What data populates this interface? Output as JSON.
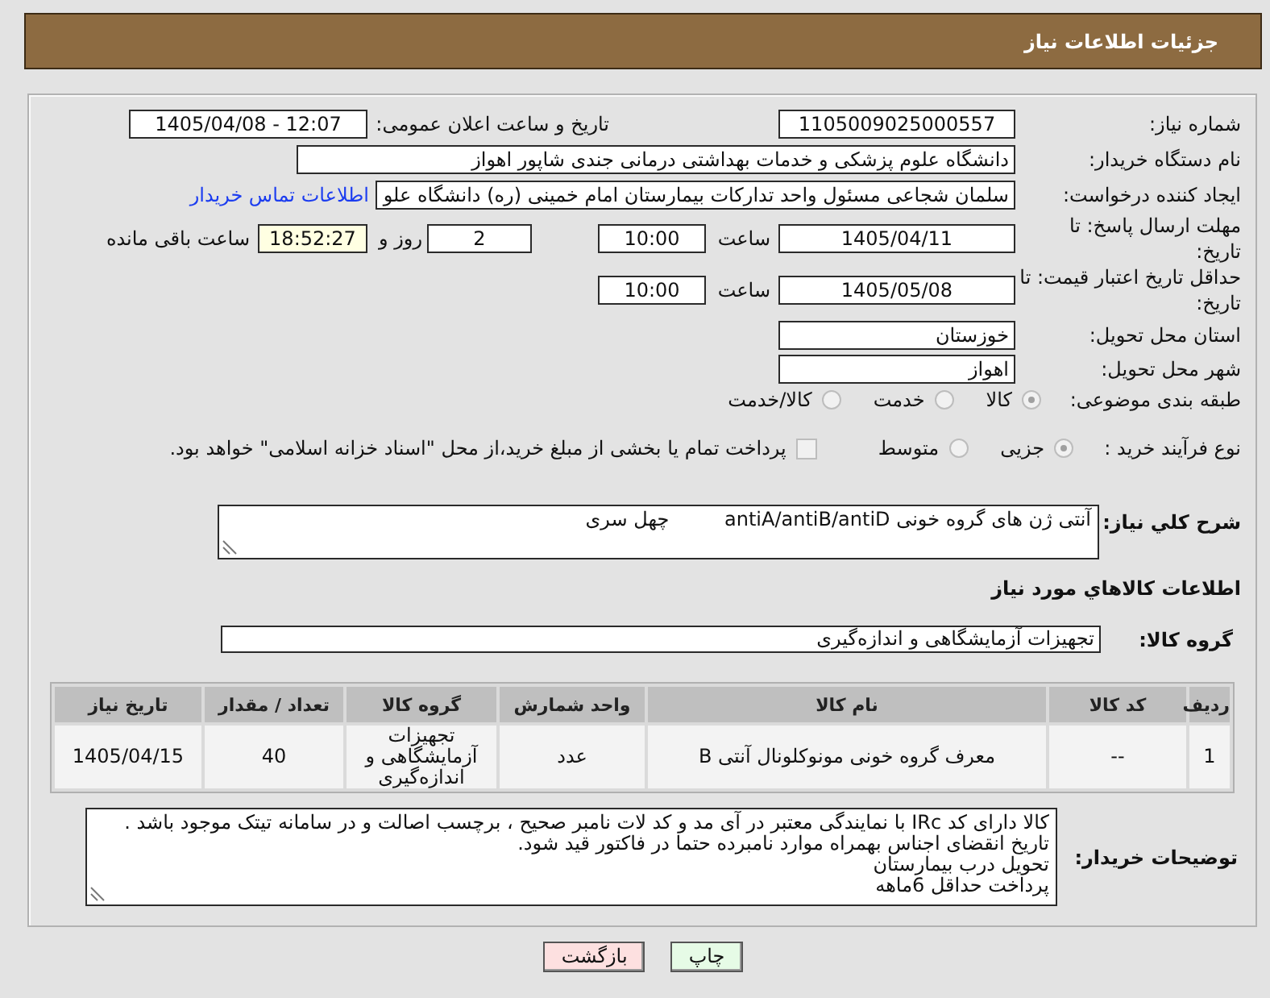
{
  "page": {
    "title": "جزئیات اطلاعات نیاز"
  },
  "need_number": {
    "label": "شماره نیاز:",
    "value": "1105009025000557"
  },
  "announce_datetime": {
    "label": "تاریخ و ساعت اعلان عمومی:",
    "value": "1405/04/08 - 12:07"
  },
  "buyer_org": {
    "label": "نام دستگاه خریدار:",
    "value": "دانشگاه علوم پزشکی و خدمات بهداشتی درمانی جندی شاپور اهواز"
  },
  "requester": {
    "label": "ایجاد کننده درخواست:",
    "value": "سلمان شجاعی مسئول واحد تدارکات بیمارستان امام خمینی (ره) دانشگاه علو",
    "link": "اطلاعات تماس خریدار"
  },
  "response_deadline": {
    "label": "مهلت ارسال پاسخ: تا تاریخ:",
    "date": "1405/04/11",
    "time_label": "ساعت",
    "time": "10:00",
    "days": "2",
    "days_label": "روز و",
    "remaining": "18:52:27",
    "remaining_label": "ساعت باقی مانده"
  },
  "price_validity": {
    "label": "حداقل تاریخ اعتبار قیمت: تا تاریخ:",
    "date": "1405/05/08",
    "time_label": "ساعت",
    "time": "10:00"
  },
  "delivery_province": {
    "label": "استان محل تحویل:",
    "value": "خوزستان"
  },
  "delivery_city": {
    "label": "شهر محل تحویل:",
    "value": "اهواز"
  },
  "category": {
    "label": "طبقه بندی موضوعی:",
    "options": [
      {
        "label": "کالا",
        "selected": true,
        "disabled": true
      },
      {
        "label": "خدمت",
        "selected": false,
        "disabled": true
      },
      {
        "label": "کالا/خدمت",
        "selected": false,
        "disabled": true
      }
    ]
  },
  "purchase_process": {
    "label": "نوع فرآیند خرید :",
    "options": [
      {
        "label": "جزیی",
        "selected": true,
        "disabled": true
      },
      {
        "label": "متوسط",
        "selected": false,
        "disabled": true
      }
    ],
    "treasury_payment": {
      "label": "پرداخت تمام یا بخشی از مبلغ خرید،از محل \"اسناد خزانه اسلامی\" خواهد بود.",
      "checked": false,
      "disabled": true
    }
  },
  "description": {
    "label": "شرح کلي نیاز:",
    "value": "آنتی ژن های گروه خونی antiA/antiB/antiD         چهل سری"
  },
  "goods_section": {
    "title": "اطلاعات کالاهاي مورد نیاز"
  },
  "goods_group": {
    "label": "گروه کالا:",
    "value": "تجهیزات آزمایشگاهی و اندازه‌گیری"
  },
  "table": {
    "columns": [
      "ردیف",
      "کد کالا",
      "نام کالا",
      "واحد شمارش",
      "گروه کالا",
      "تعداد / مقدار",
      "تاریخ نیاز"
    ],
    "rows": [
      {
        "cells": [
          "1",
          "--",
          "معرف گروه خونی مونوکلونال آنتی B",
          "عدد",
          "تجهیزات آزمایشگاهی و اندازه‌گیری",
          "40",
          "1405/04/15"
        ]
      }
    ]
  },
  "buyer_notes": {
    "label": "توضیحات خریدار:",
    "value": "کالا دارای کد IRc با نمایندگی معتبر در آی مد و کد لات نامبر صحیح ، برچسب اصالت و در سامانه تیتک موجود باشد . تاریخ انقضای اجناس بهمراه موارد نامبرده حتما در فاکتور قید شود.\nتحویل درب بیمارستان\nپرداخت حداقل 6ماهه"
  },
  "buttons": [
    {
      "label": "چاپ",
      "kind": "print"
    },
    {
      "label": "بازگشت",
      "kind": "back"
    }
  ]
}
